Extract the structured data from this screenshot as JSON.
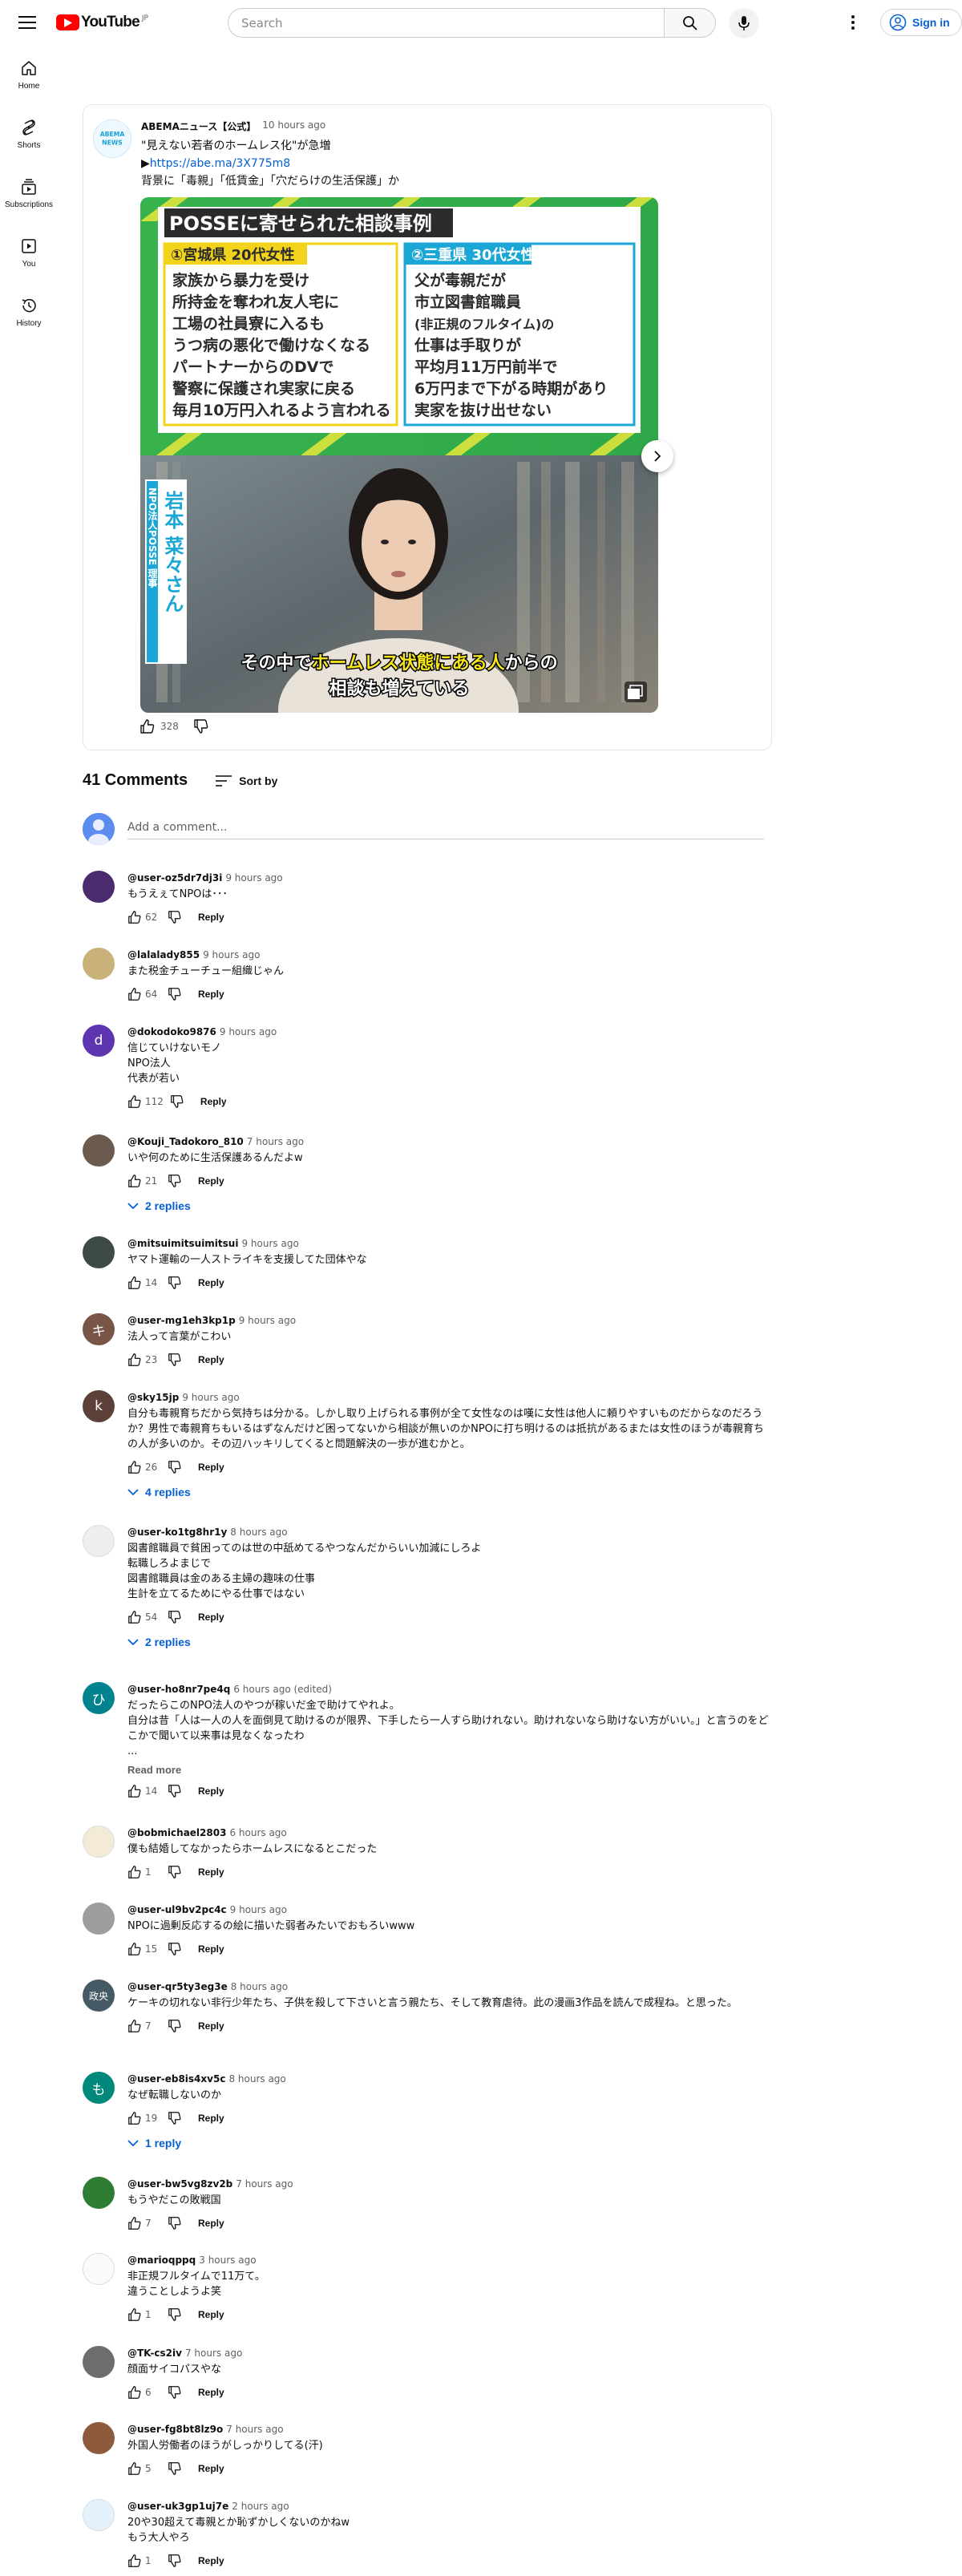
{
  "masthead": {
    "logo_text": "YouTube",
    "logo_region": "JP",
    "search_placeholder": "Search",
    "signin_label": "Sign in"
  },
  "guide": {
    "items": [
      {
        "label": "Home",
        "icon": "home-icon"
      },
      {
        "label": "Shorts",
        "icon": "shorts-icon"
      },
      {
        "label": "Subscriptions",
        "icon": "subscriptions-icon"
      },
      {
        "label": "You",
        "icon": "you-icon"
      },
      {
        "label": "History",
        "icon": "history-icon"
      }
    ]
  },
  "post": {
    "channel_name": "ABEMAニュース【公式】",
    "avatar_text": "ABEMA\nNEWS",
    "time": "10 hours ago",
    "line1": "\"見えない若者のホームレス化\"が急増",
    "link_prefix": "▶",
    "link": "https://abe.ma/3X775m8",
    "line3": "背景に「毒親」「低賃金」「穴だらけの生活保護」か",
    "likes": "328",
    "image": {
      "panel_title": "POSSEに寄せられた相談事例",
      "case1_label": "①宮城県 20代女性",
      "case1_lines": [
        "家族から暴力を受け",
        "所持金を奪われ友人宅に",
        "工場の社員寮に入るも",
        "うつ病の悪化で働けなくなる",
        "パートナーからのDVで",
        "警察に保護され実家に戻る",
        "毎月10万円入れるよう言われる"
      ],
      "case2_label": "②三重県 30代女性",
      "case2_lines": [
        "父が毒親だが",
        "市立図書館職員",
        "(非正規のフルタイム)の",
        "仕事は手取りが",
        "平均月11万円前半で",
        "6万円まで下がる時期があり",
        "実家を抜け出せない"
      ],
      "name_org": "NPO法人POSSE 理事",
      "name_person": "岩本 菜々さん",
      "subtitle_line1_a": "その中で",
      "subtitle_line1_b": "ホームレス状態にある人",
      "subtitle_line1_c": "からの",
      "subtitle_line2": "相談も増えている"
    }
  },
  "comments_header": {
    "count_label": "41 Comments",
    "sort_label": "Sort by",
    "add_placeholder": "Add a comment..."
  },
  "comment_ui": {
    "reply_label": "Reply",
    "read_more_label": "Read more"
  },
  "comments": [
    {
      "author": "@user-oz5dr7dj3i",
      "time": "9 hours ago",
      "text": "もうえぇてNPOは･･･",
      "likes": "62",
      "avatar_color": "#4a2b6e",
      "avatar_letter": ""
    },
    {
      "author": "@lalalady855",
      "time": "9 hours ago",
      "text": "また税金チューチュー組織じゃん",
      "likes": "64",
      "avatar_color": "#c9b27a",
      "avatar_letter": ""
    },
    {
      "author": "@dokodoko9876",
      "time": "9 hours ago",
      "text": "信じていけないモノ\nNPO法人\n代表が若い",
      "likes": "112",
      "avatar_color": "#5e35b1",
      "avatar_letter": "d"
    },
    {
      "author": "@Kouji_Tadokoro_810",
      "time": "7 hours ago",
      "text": "いや何のために生活保護あるんだよw",
      "likes": "21",
      "avatar_color": "#6b5a4e",
      "avatar_letter": "",
      "replies": "2 replies"
    },
    {
      "author": "@mitsuimitsuimitsui",
      "time": "9 hours ago",
      "text": "ヤマト運輸の一人ストライキを支援してた団体やな",
      "likes": "14",
      "avatar_color": "#3d4a48",
      "avatar_letter": ""
    },
    {
      "author": "@user-mg1eh3kp1p",
      "time": "9 hours ago",
      "text": "法人って言葉がこわい",
      "likes": "23",
      "avatar_color": "#795548",
      "avatar_letter": "キ"
    },
    {
      "author": "@sky15jp",
      "time": "9 hours ago",
      "text": "自分も毒親育ちだから気持ちは分かる。しかし取り上げられる事例が全て女性なのは嘆に女性は他人に頼りやすいものだからなのだろうか？男性で毒親育ちもいるはずなんだけど困ってないから相談が無いのかNPOに打ち明けるのは抵抗があるまたは女性のほうが毒親育ちの人が多いのか。その辺ハッキリしてくると問題解決の一歩が進むかと。",
      "likes": "26",
      "avatar_color": "#5d4037",
      "avatar_letter": "k",
      "replies": "4 replies"
    },
    {
      "author": "@user-ko1tg8hr1y",
      "time": "8 hours ago",
      "text": "図書館職員で貧困ってのは世の中舐めてるやつなんだからいい加減にしろよ\n転職しろよまじで\n図書館職員は金のある主婦の趣味の仕事\n生計を立てるためにやる仕事ではない",
      "likes": "54",
      "avatar_color": "#eeeeee",
      "avatar_letter": "",
      "replies": "2 replies"
    },
    {
      "author": "@user-ho8nr7pe4q",
      "time": "6 hours ago (edited)",
      "text": "だったらこのNPO法人のやつが稼いだ金で助けてやれよ。\n自分は昔「人は一人の人を面倒見て助けるのが限界、下手したら一人すら助けれない。助けれないなら助けない方がいい。」と言うのをどこかで聞いて以来事は見なくなったわ\n...",
      "likes": "14",
      "avatar_color": "#00838f",
      "avatar_letter": "ひ",
      "read_more": true
    },
    {
      "author": "@bobmichael2803",
      "time": "6 hours ago",
      "text": "僕も結婚してなかったらホームレスになるとこだった",
      "likes": "1",
      "avatar_color": "#f3ead8",
      "avatar_letter": ""
    },
    {
      "author": "@user-ul9bv2pc4c",
      "time": "9 hours ago",
      "text": "NPOに過剰反応するの絵に描いた弱者みたいでおもろいwww",
      "likes": "15",
      "avatar_color": "#9e9e9e",
      "avatar_letter": ""
    },
    {
      "author": "@user-qr5ty3eg3e",
      "time": "8 hours ago",
      "text": "ケーキの切れない非行少年たち、子供を殺して下さいと言う親たち、そして教育虐待。此の漫画3作品を読んで成程ね。と思った。",
      "likes": "7",
      "avatar_color": "#455a64",
      "avatar_letter": "政央"
    },
    {
      "author": "@user-eb8is4xv5c",
      "time": "8 hours ago",
      "text": "なぜ転職しないのか",
      "likes": "19",
      "avatar_color": "#00897b",
      "avatar_letter": "も",
      "replies": "1 reply"
    },
    {
      "author": "@user-bw5vg8zv2b",
      "time": "7 hours ago",
      "text": "もうやだこの敗戦国",
      "likes": "7",
      "avatar_color": "#2e7d32",
      "avatar_letter": ""
    },
    {
      "author": "@marioqppq",
      "time": "3 hours ago",
      "text": "非正規フルタイムで11万て。\n違うことしようよ笑",
      "likes": "1",
      "avatar_color": "#fafafa",
      "avatar_letter": ""
    },
    {
      "author": "@TK-cs2iv",
      "time": "7 hours ago",
      "text": "顔面サイコパスやな",
      "likes": "6",
      "avatar_color": "#6d6d6d",
      "avatar_letter": ""
    },
    {
      "author": "@user-fg8bt8lz9o",
      "time": "7 hours ago",
      "text": "外国人労働者のほうがしっかりしてる(汗)",
      "likes": "5",
      "avatar_color": "#8d5a3c",
      "avatar_letter": ""
    },
    {
      "author": "@user-uk3gp1uj7e",
      "time": "2 hours ago",
      "text": "20や30超えて毒親とか恥ずかしくないのかねw\nもう大人やろ",
      "likes": "1",
      "avatar_color": "#e3f2fd",
      "avatar_letter": ""
    }
  ]
}
